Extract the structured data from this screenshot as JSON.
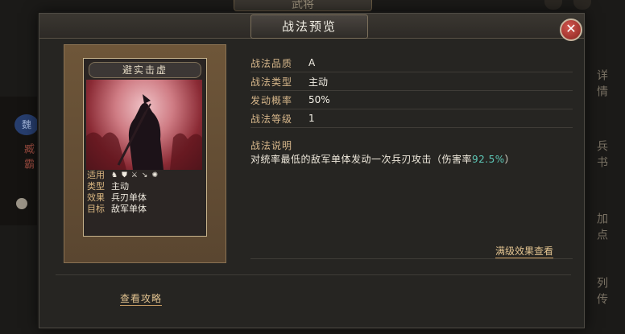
{
  "background": {
    "top_title": "武将",
    "left_badge": "魏",
    "left_name": "臧霸",
    "right_tabs": [
      "详情",
      "兵书",
      "加点",
      "列传"
    ]
  },
  "modal": {
    "title": "战法预览",
    "close_icon": "close-icon"
  },
  "card": {
    "name": "避实击虚",
    "stats": [
      {
        "key": "适用",
        "icons": [
          "cavalry-icon",
          "shield-icon",
          "bow-icon",
          "spear-icon",
          "siege-icon"
        ]
      },
      {
        "key": "类型",
        "value": "主动"
      },
      {
        "key": "效果",
        "value": "兵刃单体"
      },
      {
        "key": "目标",
        "value": "敌军单体"
      }
    ]
  },
  "info": {
    "rows": [
      {
        "label": "战法品质",
        "value": "A"
      },
      {
        "label": "战法类型",
        "value": "主动"
      },
      {
        "label": "发动概率",
        "value": "50%"
      },
      {
        "label": "战法等级",
        "value": "1"
      }
    ],
    "desc_label": "战法说明",
    "desc_text_before": "对统率最低的敌军单体发动一次兵刃攻击（伤害率",
    "desc_pct": "92.5%",
    "desc_text_after": "）",
    "max_effect_link": "满级效果查看"
  },
  "footer": {
    "guide_link": "查看攻略"
  },
  "colors": {
    "accent_gold": "#d7b78b",
    "percent_teal": "#5ec9b8",
    "close_red": "#b8332d"
  }
}
